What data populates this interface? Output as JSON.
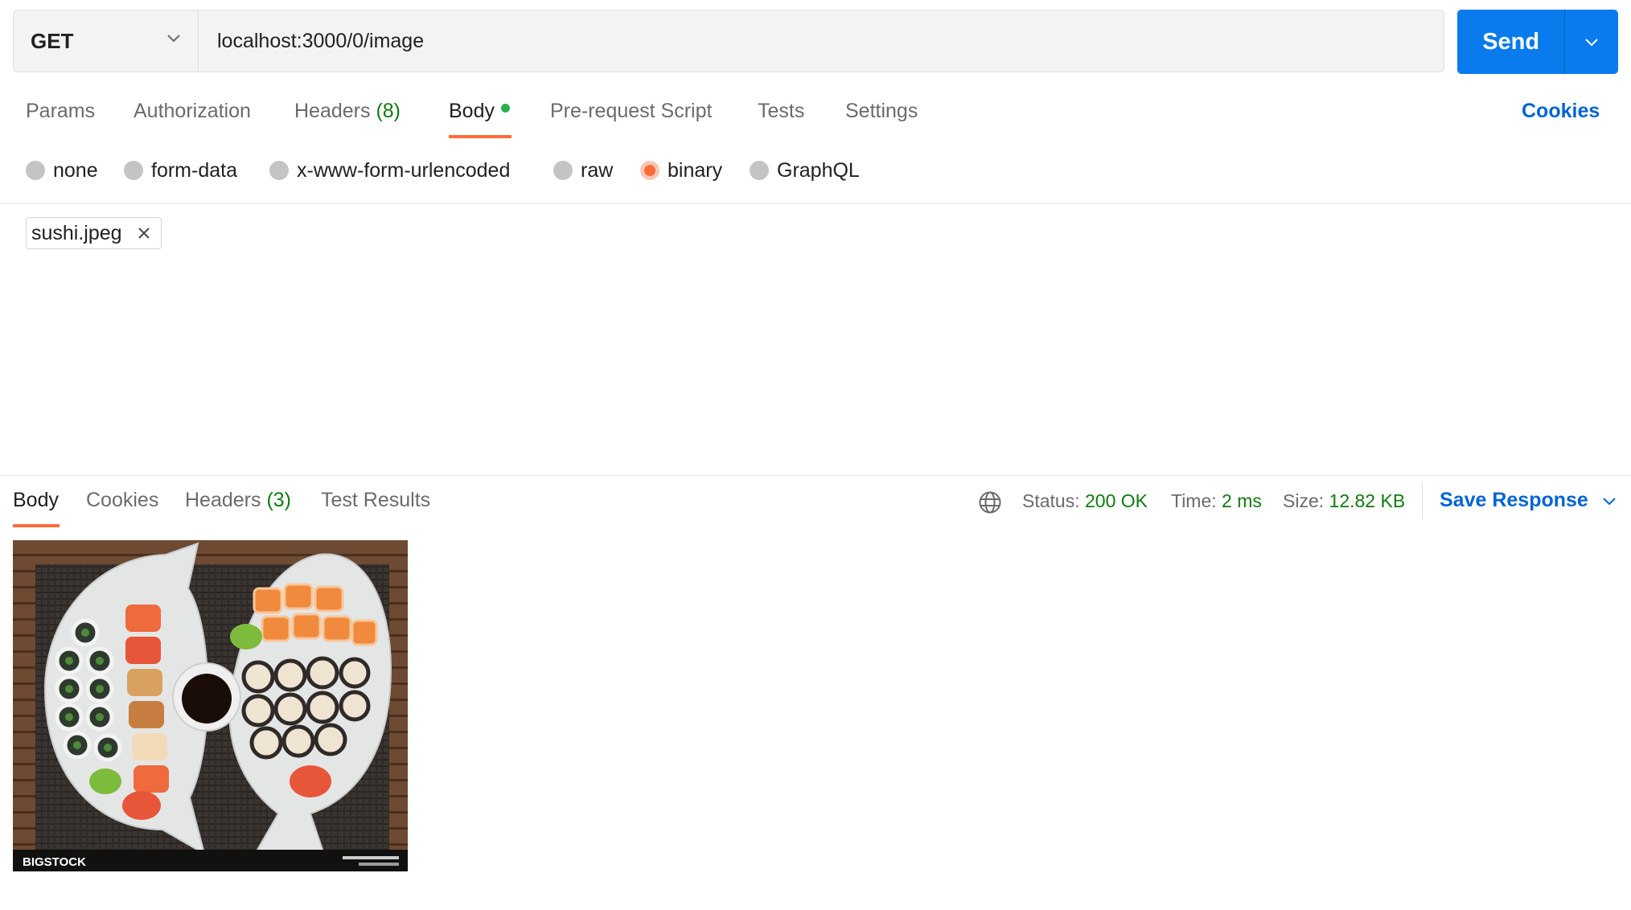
{
  "request": {
    "method": "GET",
    "url": "localhost:3000/0/image",
    "send_label": "Send"
  },
  "request_tabs": [
    {
      "label": "Params"
    },
    {
      "label": "Authorization"
    },
    {
      "label": "Headers",
      "count": "(8)"
    },
    {
      "label": "Body"
    },
    {
      "label": "Pre-request Script"
    },
    {
      "label": "Tests"
    },
    {
      "label": "Settings"
    }
  ],
  "cookies_label": "Cookies",
  "body_types": [
    {
      "label": "none"
    },
    {
      "label": "form-data"
    },
    {
      "label": "x-www-form-urlencoded"
    },
    {
      "label": "raw"
    },
    {
      "label": "binary",
      "selected": true
    },
    {
      "label": "GraphQL"
    }
  ],
  "file": {
    "name": "sushi.jpeg"
  },
  "response": {
    "tabs": [
      {
        "label": "Body"
      },
      {
        "label": "Cookies"
      },
      {
        "label": "Headers",
        "count": "(3)"
      },
      {
        "label": "Test Results"
      }
    ],
    "status_label": "Status:",
    "status_value": "200 OK",
    "time_label": "Time:",
    "time_value": "2 ms",
    "size_label": "Size:",
    "size_value": "12.82 KB",
    "save_label": "Save Response",
    "image": {
      "watermark": "BIGSTOCK"
    }
  },
  "colors": {
    "accent": "#ff6c37",
    "send_button": "#097bed",
    "link": "#0265d2",
    "success": "#0f7b0f",
    "body_dot": "#26b24a"
  }
}
